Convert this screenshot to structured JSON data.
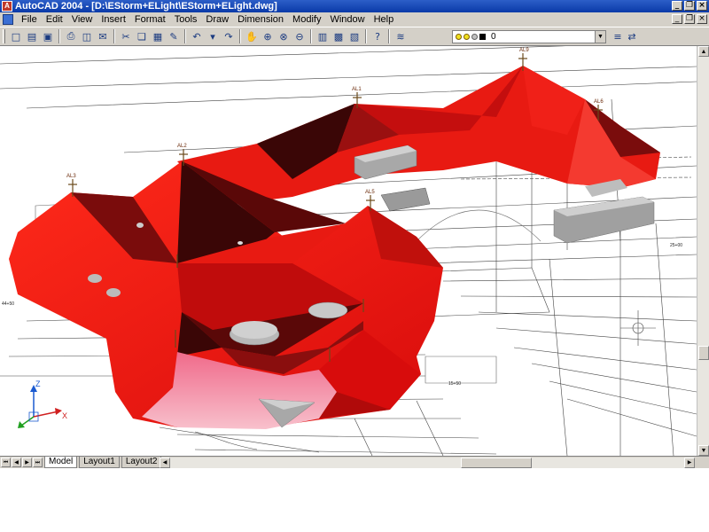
{
  "window": {
    "title": "AutoCAD 2004 - [D:\\EStorm+ELight\\EStorm+ELight.dwg]"
  },
  "menu": {
    "items": [
      "File",
      "Edit",
      "View",
      "Insert",
      "Format",
      "Tools",
      "Draw",
      "Dimension",
      "Modify",
      "Window",
      "Help"
    ]
  },
  "toolbar": {
    "layer_value": "0"
  },
  "tabs": {
    "model": "Model",
    "layout1": "Layout1",
    "layout2": "Layout2"
  },
  "ucs": {
    "z": "Z",
    "x": "X"
  },
  "poles": [
    "AL9",
    "AL1",
    "AL2",
    "AL3",
    "AL5",
    "AL6"
  ],
  "drawing_labels": [
    "25+00",
    "44+50",
    "15+50"
  ],
  "colors": {
    "surface": "#e81818",
    "surface_dark": "#7a0c0c",
    "surface_light": "#f4a0b4",
    "building": "#b8b8b8",
    "title": "#0a3aa8"
  }
}
